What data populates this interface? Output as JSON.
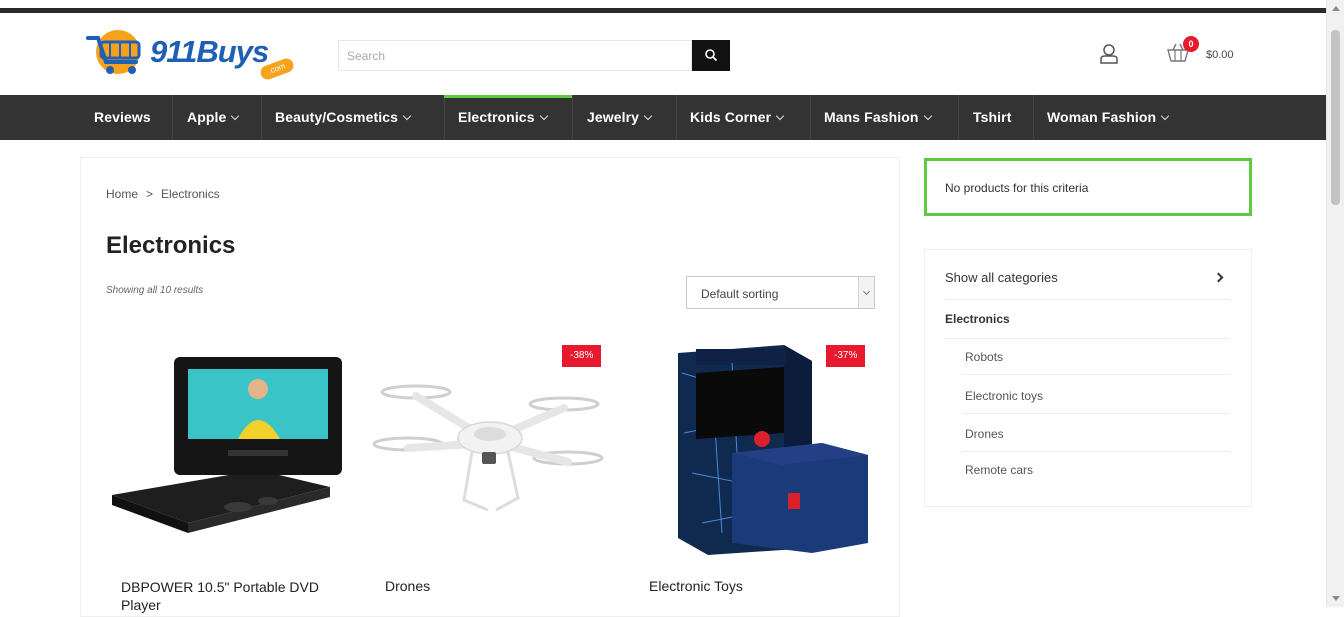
{
  "header": {
    "logo_text": "911Buys",
    "logo_domain": ".com",
    "search_placeholder": "Search",
    "cart_count": "0",
    "cart_total": "$0.00"
  },
  "nav": {
    "items": [
      {
        "label": "Reviews",
        "dropdown": false
      },
      {
        "label": "Apple",
        "dropdown": true
      },
      {
        "label": "Beauty/Cosmetics",
        "dropdown": true
      },
      {
        "label": "Electronics",
        "dropdown": true,
        "active": true
      },
      {
        "label": "Jewelry",
        "dropdown": true
      },
      {
        "label": "Kids Corner",
        "dropdown": true
      },
      {
        "label": "Mans Fashion",
        "dropdown": true
      },
      {
        "label": "Tshirt",
        "dropdown": false
      },
      {
        "label": "Woman Fashion",
        "dropdown": true
      }
    ]
  },
  "breadcrumb": {
    "home": "Home",
    "separator": ">",
    "current": "Electronics"
  },
  "page": {
    "title": "Electronics",
    "results": "Showing all 10 results",
    "sort_selected": "Default sorting"
  },
  "products": [
    {
      "name": "DBPOWER 10.5\" Portable DVD Player",
      "badge": ""
    },
    {
      "name": "Drones",
      "badge": "-38%"
    },
    {
      "name": "Electronic Toys",
      "badge": "-37%"
    }
  ],
  "sidebar": {
    "notice": "No products for this criteria",
    "show_all": "Show all categories",
    "current_category": "Electronics",
    "subcategories": [
      "Robots",
      "Electronic toys",
      "Drones",
      "Remote cars"
    ]
  },
  "colors": {
    "nav_bg": "#333333",
    "accent_green": "#5fca3f",
    "sale_red": "#e8192c",
    "logo_blue": "#1f5fb5",
    "logo_orange": "#f7a21b"
  }
}
